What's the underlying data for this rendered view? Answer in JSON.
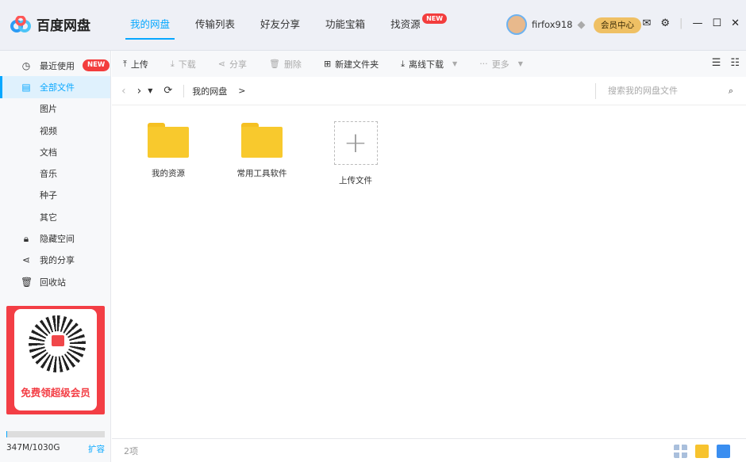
{
  "app": {
    "name": "百度网盘"
  },
  "nav": [
    {
      "label": "我的网盘",
      "active": true
    },
    {
      "label": "传输列表"
    },
    {
      "label": "好友分享"
    },
    {
      "label": "功能宝箱"
    },
    {
      "label": "找资源",
      "badge": "NEW"
    }
  ],
  "user": {
    "name": "firfox918",
    "vip_label": "会员中心"
  },
  "sidebar": {
    "items": [
      {
        "label": "最近使用",
        "icon": "clock-icon",
        "badge": "NEW"
      },
      {
        "label": "全部文件",
        "icon": "file-icon",
        "active": true
      },
      {
        "label": "图片",
        "sub": true
      },
      {
        "label": "视频",
        "sub": true
      },
      {
        "label": "文档",
        "sub": true
      },
      {
        "label": "音乐",
        "sub": true
      },
      {
        "label": "种子",
        "sub": true
      },
      {
        "label": "其它",
        "sub": true
      },
      {
        "label": "隐藏空间",
        "icon": "lock-icon"
      },
      {
        "label": "我的分享",
        "icon": "share-icon"
      },
      {
        "label": "回收站",
        "icon": "trash-icon"
      }
    ],
    "promo": "免费领超级会员",
    "storage": {
      "used": "347M/1030G",
      "expand": "扩容",
      "fill_percent": 1
    }
  },
  "toolbar": {
    "upload": "上传",
    "download": "下载",
    "share": "分享",
    "delete": "删除",
    "new_folder": "新建文件夹",
    "offline": "离线下载",
    "more": "更多"
  },
  "path": {
    "crumb": "我的网盘",
    "sep": ">",
    "search_placeholder": "搜索我的网盘文件"
  },
  "files": [
    {
      "name": "我的资源"
    },
    {
      "name": "常用工具软件"
    }
  ],
  "upload_tile": "上传文件",
  "footer": {
    "count": "2项"
  }
}
